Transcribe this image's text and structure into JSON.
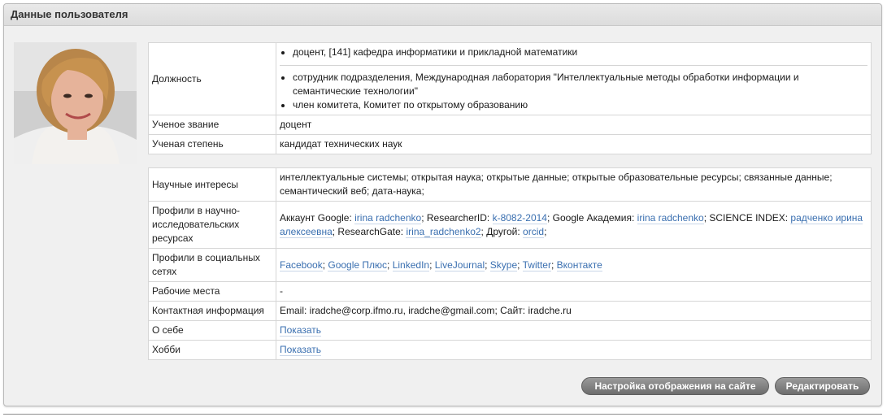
{
  "panel": {
    "title": "Данные пользователя"
  },
  "profile_table_1": {
    "position_label": "Должность",
    "position_items": [
      "доцент, [141] кафедра информатики и прикладной математики",
      "сотрудник подразделения, Международная лаборатория \"Интеллектуальные методы обработки информации и семантические технологии\"",
      "член комитета, Комитет по открытому образованию"
    ],
    "title_label": "Ученое звание",
    "title_value": "доцент",
    "degree_label": "Ученая степень",
    "degree_value": "кандидат технических наук"
  },
  "profile_table_2": {
    "interests_label": "Научные интересы",
    "interests_value": "интеллектуальные системы; открытая наука; открытые данные; открытые образовательные ресурсы; связанные данные; семантический веб; дата-наука;",
    "research_profiles_label": "Профили в научно-исследовательских ресурсах",
    "research_profiles": {
      "google_account_label": "Аккаунт Google: ",
      "google_account_link": "irina radchenko",
      "researcherid_label": "; ResearcherID: ",
      "researcherid_link": "k-8082-2014",
      "scholar_label": "; Google Академия: ",
      "scholar_link": "irina radchenko",
      "science_index_label": "; SCIENCE INDEX: ",
      "science_index_link": "радченко ирина алексеевна",
      "researchgate_label": "; ResearchGate: ",
      "researchgate_link": "irina_radchenko2",
      "other_label": "; Другой: ",
      "other_link": "orcid",
      "tail": ";"
    },
    "social_label": "Профили в социальных сетях",
    "social_links": [
      "Facebook",
      "Google Плюс",
      "LinkedIn",
      "LiveJournal",
      "Skype",
      "Twitter",
      "Вконтакте"
    ],
    "workplaces_label": "Рабочие места",
    "workplaces_value": "-",
    "contact_label": "Контактная информация",
    "contact_value": "Email: iradche@corp.ifmo.ru, iradche@gmail.com; Сайт: iradche.ru",
    "about_label": "О себе",
    "about_link": "Показать",
    "hobby_label": "Хобби",
    "hobby_link": "Показать"
  },
  "buttons": {
    "display_settings": "Настройка отображения на сайте",
    "edit": "Редактировать"
  }
}
